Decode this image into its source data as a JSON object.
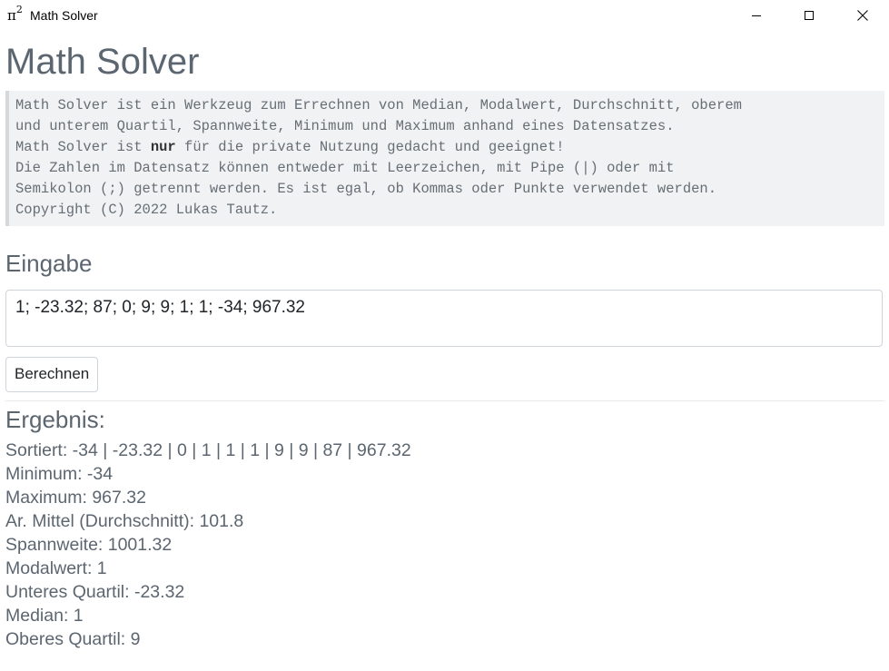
{
  "window": {
    "icon_text": "π",
    "icon_sup": "2",
    "title": "Math Solver"
  },
  "page": {
    "title": "Math Solver",
    "description": {
      "line1": "Math Solver ist ein Werkzeug zum Errechnen von Median, Modalwert, Durchschnitt, oberem",
      "line2": "und unterem Quartil, Spannweite, Minimum und Maximum anhand eines Datensatzes.",
      "line3_pre": "Math Solver ist ",
      "line3_bold": "nur",
      "line3_post": " für die private Nutzung gedacht und geeignet!",
      "line4": "Die Zahlen im Datensatz können entweder mit Leerzeichen, mit Pipe (|) oder mit",
      "line5": "Semikolon (;) getrennt werden. Es ist egal, ob Kommas oder Punkte verwendet werden.",
      "line6": "Copyright (C) 2022 Lukas Tautz."
    }
  },
  "input": {
    "heading": "Eingabe",
    "value": "1; -23.32; 87; 0; 9; 9; 1; 1; -34; 967.32",
    "button_label": "Berechnen"
  },
  "result": {
    "heading": "Ergebnis:",
    "sorted": "Sortiert: -34 | -23.32 | 0 | 1 | 1 | 1 | 9 | 9 | 87 | 967.32",
    "minimum": "Minimum: -34",
    "maximum": "Maximum: 967.32",
    "mean": "Ar. Mittel (Durchschnitt): 101.8",
    "range": "Spannweite: 1001.32",
    "mode": "Modalwert: 1",
    "lower_quartile": "Unteres Quartil: -23.32",
    "median": "Median: 1",
    "upper_quartile": "Oberes Quartil: 9"
  }
}
